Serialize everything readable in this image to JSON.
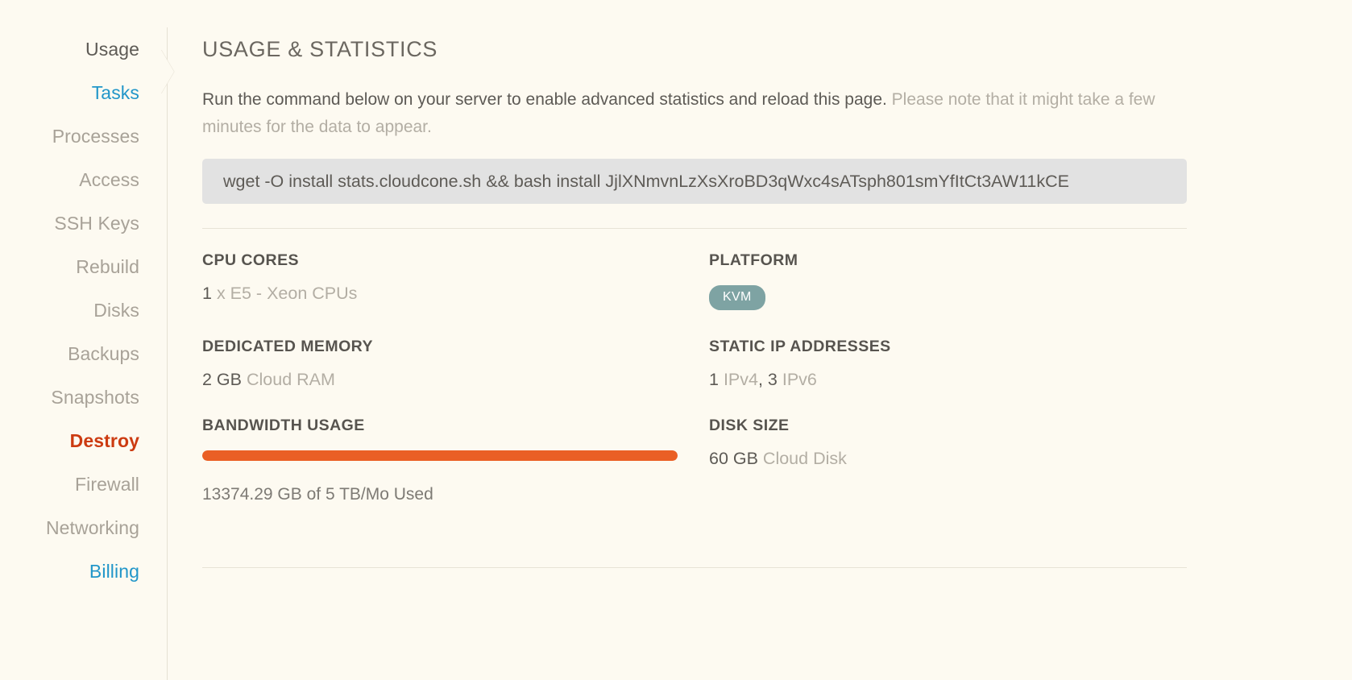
{
  "sidebar": {
    "items": [
      {
        "label": "Usage",
        "style": "is-dark"
      },
      {
        "label": "Tasks",
        "style": "is-link"
      },
      {
        "label": "Processes",
        "style": ""
      },
      {
        "label": "Access",
        "style": ""
      },
      {
        "label": "SSH Keys",
        "style": ""
      },
      {
        "label": "Rebuild",
        "style": ""
      },
      {
        "label": "Disks",
        "style": ""
      },
      {
        "label": "Backups",
        "style": ""
      },
      {
        "label": "Snapshots",
        "style": ""
      },
      {
        "label": "Destroy",
        "style": "is-danger"
      },
      {
        "label": "Firewall",
        "style": ""
      },
      {
        "label": "Networking",
        "style": ""
      },
      {
        "label": "Billing",
        "style": "is-link"
      }
    ]
  },
  "main": {
    "title": "USAGE & STATISTICS",
    "intro_primary": "Run the command below on your server to enable advanced statistics and reload this page.",
    "intro_muted": " Please note that it might take a few minutes for the data to appear.",
    "command": "wget -O install stats.cloudcone.sh && bash install JjlXNmvnLzXsXroBD3qWxc4sATsph801smYfItCt3AW11kCE"
  },
  "stats": {
    "cpu_cores": {
      "label": "CPU CORES",
      "value": "1",
      "suffix": " x E5 - Xeon CPUs"
    },
    "platform": {
      "label": "PLATFORM",
      "badge": "KVM"
    },
    "memory": {
      "label": "DEDICATED MEMORY",
      "value": "2 GB",
      "suffix": " Cloud RAM"
    },
    "static_ips": {
      "label": "STATIC IP ADDRESSES",
      "ipv4_count": "1",
      "ipv4_label": " IPv4",
      "separator": ", ",
      "ipv6_count": "3",
      "ipv6_label": " IPv6"
    },
    "bandwidth": {
      "label": "BANDWIDTH USAGE",
      "caption": "13374.29 GB of 5 TB/Mo Used",
      "percent": 100
    },
    "disk_size": {
      "label": "DISK SIZE",
      "value": "60 GB",
      "suffix": " Cloud Disk"
    }
  },
  "colors": {
    "background": "#fdfaf1",
    "link": "#2196c9",
    "danger": "#cc3b11",
    "accent_bar": "#ea5f25",
    "badge": "#7ea3a3",
    "command_bg": "#e2e2e2"
  }
}
